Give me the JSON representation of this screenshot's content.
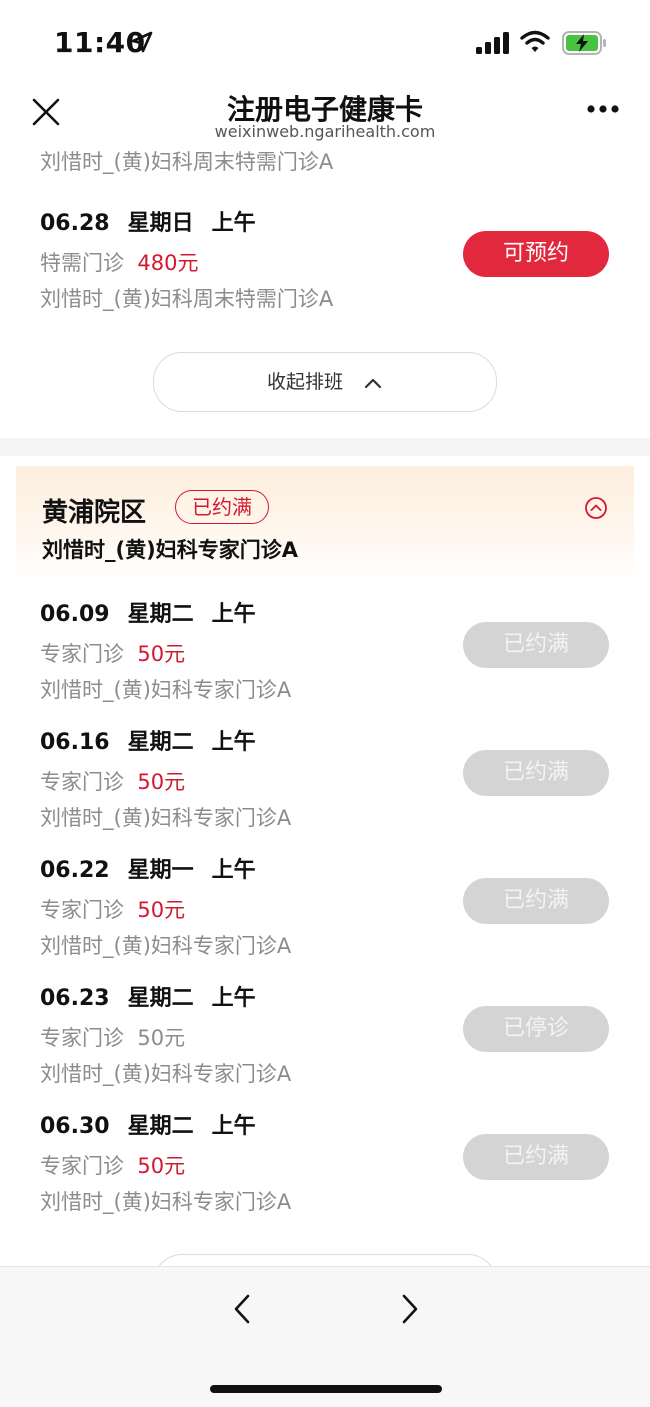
{
  "status": {
    "time": "11:40"
  },
  "nav": {
    "title": "注册电子健康卡",
    "subtitle": "weixinweb.ngarihealth.com"
  },
  "top_partial": {
    "doctor_clinic": "刘惜时_(黄)妇科周末特需门诊A"
  },
  "top_slot": {
    "date": "06.28",
    "weekday": "星期日",
    "period": "上午",
    "type": "特需门诊",
    "price": "480元",
    "doctor_clinic": "刘惜时_(黄)妇科周末特需门诊A",
    "button": "可预约"
  },
  "collapse": {
    "label": "收起排班"
  },
  "campus": {
    "name": "黄浦院区",
    "badge": "已约满",
    "doctor_clinic": "刘惜时_(黄)妇科专家门诊A"
  },
  "slots": [
    {
      "date": "06.09",
      "weekday": "星期二",
      "period": "上午",
      "type": "专家门诊",
      "price": "50元",
      "doctor_clinic": "刘惜时_(黄)妇科专家门诊A",
      "button": "已约满"
    },
    {
      "date": "06.16",
      "weekday": "星期二",
      "period": "上午",
      "type": "专家门诊",
      "price": "50元",
      "doctor_clinic": "刘惜时_(黄)妇科专家门诊A",
      "button": "已约满"
    },
    {
      "date": "06.22",
      "weekday": "星期一",
      "period": "上午",
      "type": "专家门诊",
      "price": "50元",
      "doctor_clinic": "刘惜时_(黄)妇科专家门诊A",
      "button": "已约满"
    },
    {
      "date": "06.23",
      "weekday": "星期二",
      "period": "上午",
      "type": "专家门诊",
      "price": "50元",
      "doctor_clinic": "刘惜时_(黄)妇科专家门诊A",
      "button": "已停诊"
    },
    {
      "date": "06.30",
      "weekday": "星期二",
      "period": "上午",
      "type": "专家门诊",
      "price": "50元",
      "doctor_clinic": "刘惜时_(黄)妇科专家门诊A",
      "button": "已约满"
    }
  ],
  "icons": {
    "close": "close-icon",
    "more": "more-icon",
    "location": "location-arrow-icon",
    "signal": "signal-icon",
    "wifi": "wifi-icon",
    "battery": "battery-charging-icon",
    "collapse": "chevron-up-icon",
    "campus_toggle": "circle-chevron-up-icon",
    "back": "chevron-left-icon",
    "forward": "chevron-right-icon"
  },
  "colors": {
    "accent": "#e1283c",
    "price_red": "#d4192e",
    "disabled": "#d4d4d4"
  }
}
